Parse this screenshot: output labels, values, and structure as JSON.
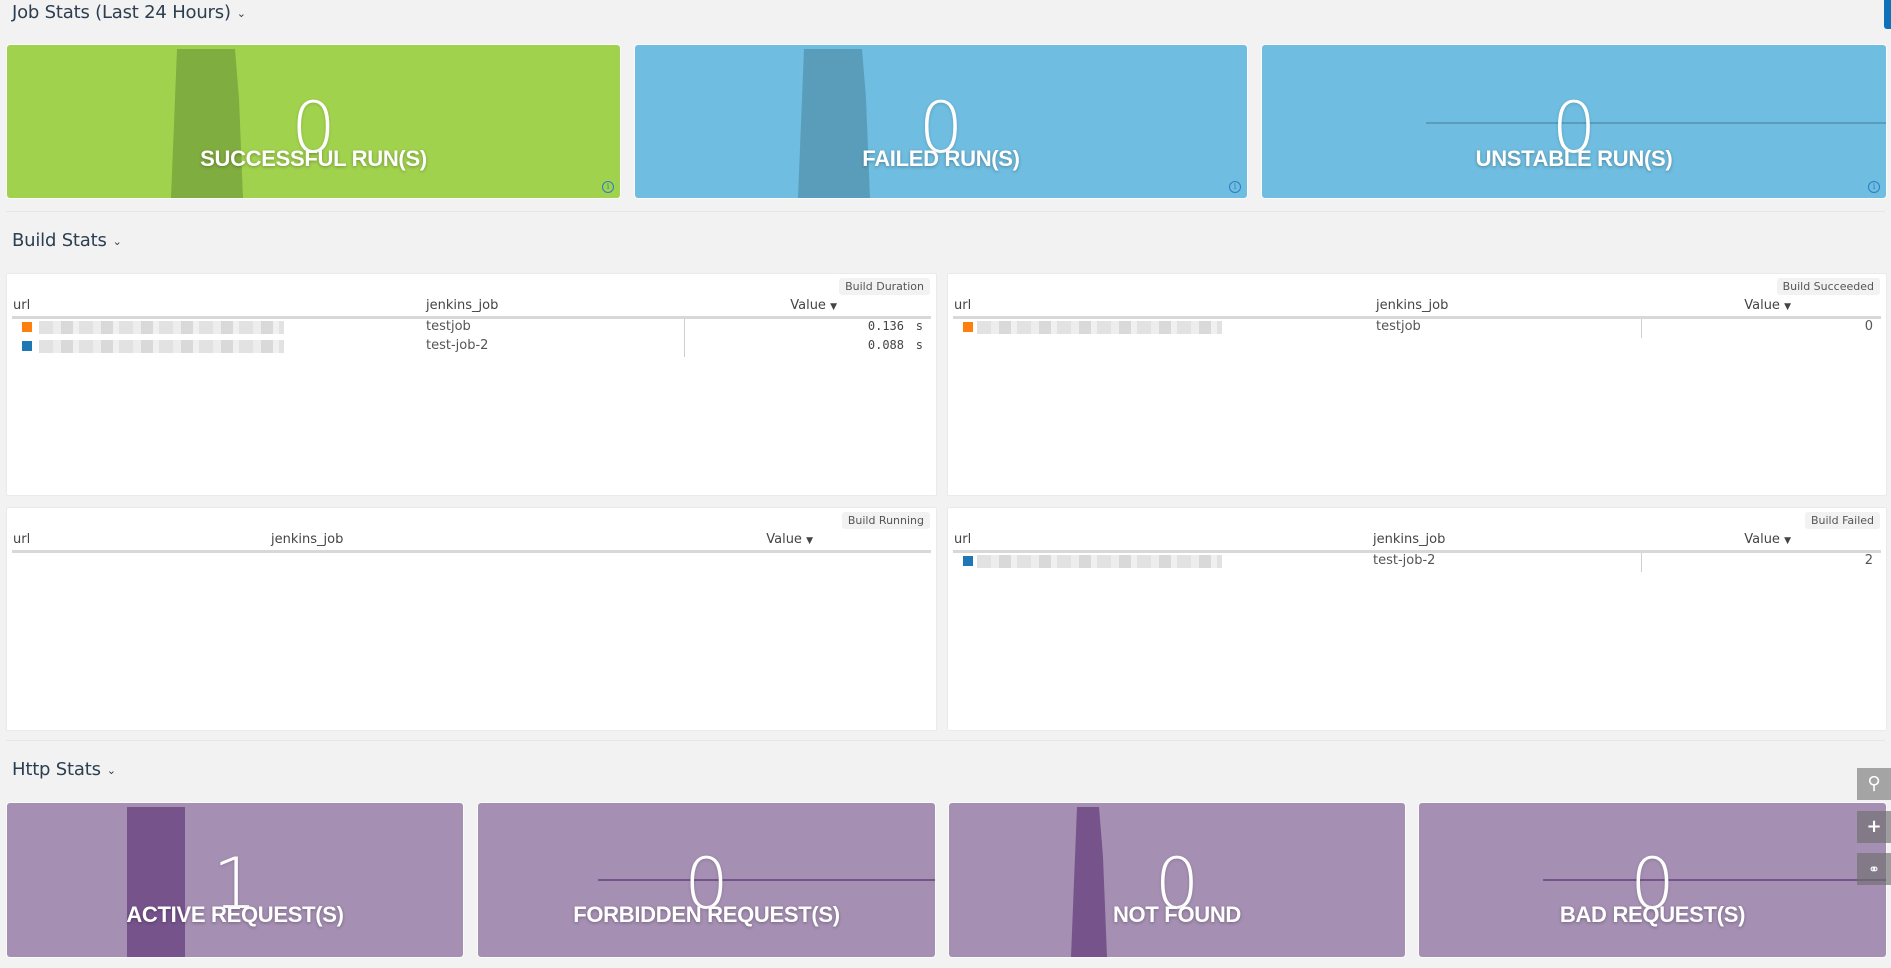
{
  "help_button": {
    "label": "?"
  },
  "sections": {
    "job_stats": {
      "title": "Job Stats (Last 24 Hours)"
    },
    "build_stats": {
      "title": "Build Stats"
    },
    "http_stats": {
      "title": "Http Stats"
    }
  },
  "job_cards": [
    {
      "value": "0",
      "label": "SUCCESSFUL RUN(S)",
      "bg": "#a1d24e",
      "spark": "#80ad3f",
      "spark_type": "spike"
    },
    {
      "value": "0",
      "label": "FAILED RUN(S)",
      "bg": "#6fbde0",
      "spark": "#5a9dbb",
      "spark_type": "spike"
    },
    {
      "value": "0",
      "label": "UNSTABLE RUN(S)",
      "bg": "#6fbde0",
      "spark": "#5a9dbb",
      "spark_type": "flat"
    }
  ],
  "tables": {
    "build_duration": {
      "badge": "Build Duration",
      "columns": [
        "url",
        "jenkins_job",
        "Value"
      ],
      "rows": [
        {
          "color": "#ff7f0e",
          "jenkins_job": "testjob",
          "value": "0.136",
          "unit": "s"
        },
        {
          "color": "#1f77b4",
          "jenkins_job": "test-job-2",
          "value": "0.088",
          "unit": "s"
        }
      ]
    },
    "build_succeeded": {
      "badge": "Build Succeeded",
      "columns": [
        "url",
        "jenkins_job",
        "Value"
      ],
      "rows": [
        {
          "color": "#ff7f0e",
          "jenkins_job": "testjob",
          "value": "0"
        }
      ]
    },
    "build_running": {
      "badge": "Build Running",
      "columns": [
        "url",
        "jenkins_job",
        "Value"
      ],
      "rows": []
    },
    "build_failed": {
      "badge": "Build Failed",
      "columns": [
        "url",
        "jenkins_job",
        "Value"
      ],
      "rows": [
        {
          "color": "#1f77b4",
          "jenkins_job": "test-job-2",
          "value": "2"
        }
      ]
    }
  },
  "sort_icon": "triangle-down",
  "http_cards": [
    {
      "value": "1",
      "label": "ACTIVE REQUEST(S)",
      "bg": "#a58fb3",
      "spark": "#77538c",
      "spark_type": "bar"
    },
    {
      "value": "0",
      "label": "FORBIDDEN REQUEST(S)",
      "bg": "#a58fb3",
      "spark": "#77538c",
      "spark_type": "flat"
    },
    {
      "value": "0",
      "label": "NOT FOUND",
      "bg": "#a58fb3",
      "spark": "#77538c",
      "spark_type": "spike"
    },
    {
      "value": "0",
      "label": "BAD REQUEST(S)",
      "bg": "#a58fb3",
      "spark": "#77538c",
      "spark_type": "flat"
    }
  ],
  "side_tools": [
    {
      "icon": "search-icon",
      "glyph": "⚲"
    },
    {
      "icon": "plus-icon",
      "glyph": "+"
    },
    {
      "icon": "link-icon",
      "glyph": "⚯"
    }
  ]
}
